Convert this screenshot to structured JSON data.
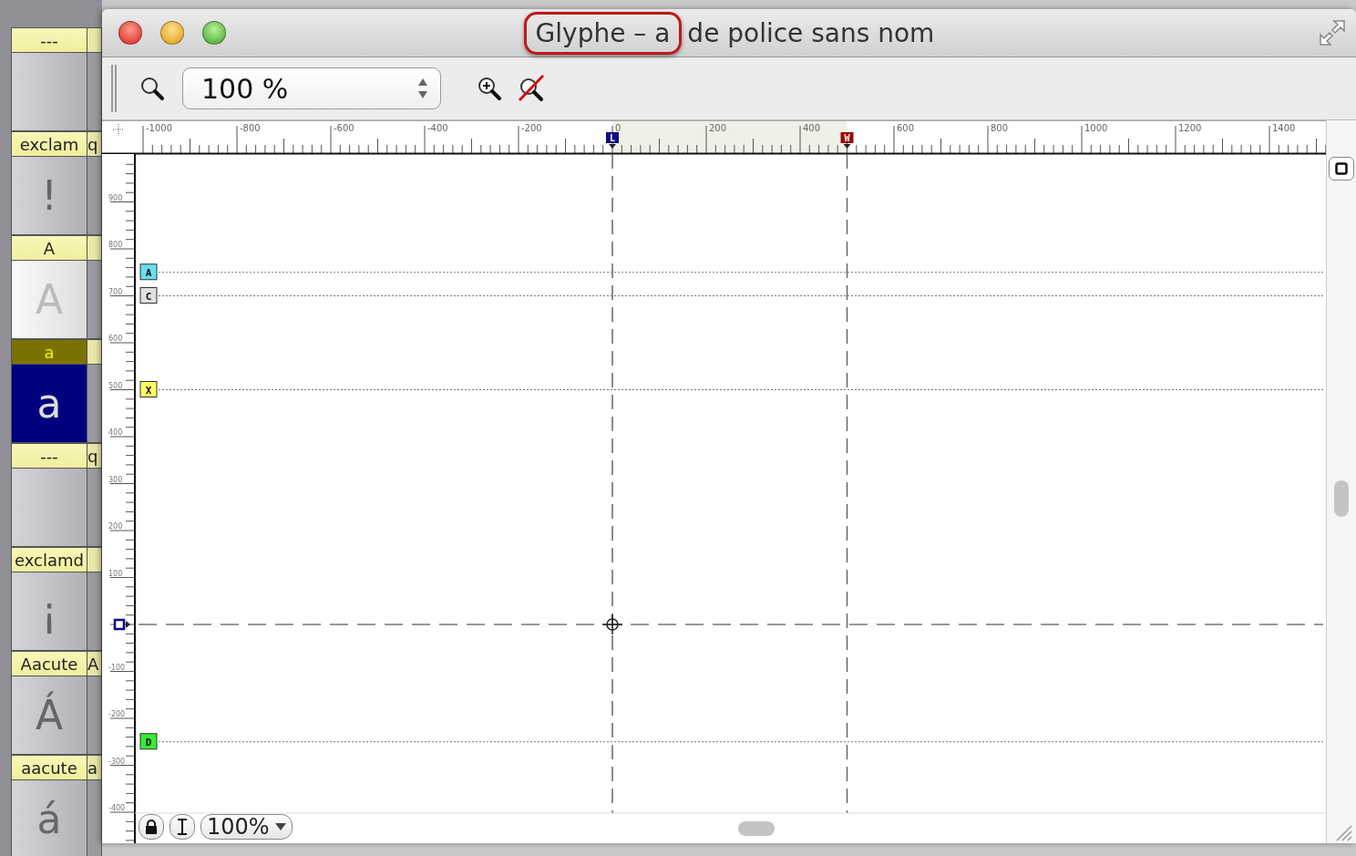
{
  "glyph_grid": [
    {
      "name": "---",
      "selected": false,
      "highlighted": false
    },
    {
      "name": "exclam",
      "glyph": "!",
      "neighbor": "q",
      "selected": false,
      "highlighted": false
    },
    {
      "name": "A",
      "glyph": "A",
      "selected": false,
      "highlighted": true
    },
    {
      "name": "a",
      "glyph": "a",
      "selected": true,
      "highlighted": false
    },
    {
      "name": "---",
      "neighbor": "q",
      "selected": false,
      "highlighted": false
    },
    {
      "name": "exclamd",
      "glyph": "¡",
      "selected": false,
      "highlighted": false
    },
    {
      "name": "Aacute",
      "glyph": "Á",
      "neighbor": "A",
      "selected": false,
      "highlighted": false
    },
    {
      "name": "aacute",
      "glyph": "á",
      "neighbor": "a",
      "selected": false,
      "highlighted": false
    }
  ],
  "window": {
    "title_parts": [
      {
        "text": "Glyphe – a",
        "highlighted": true
      },
      {
        "text": "de police sans nom",
        "highlighted": false
      }
    ]
  },
  "toolbar": {
    "zoom_field": {
      "value": "100 %"
    }
  },
  "rulers": {
    "horizontal": [
      "-1000",
      "-800",
      "-600",
      "-400",
      "-200",
      "0",
      "200",
      "400",
      "600",
      "800",
      "1000",
      "1200",
      "1400"
    ],
    "vertical": [
      "900",
      "800",
      "700",
      "600",
      "500",
      "400",
      "300",
      "200",
      "100",
      "-100",
      "-200",
      "-300",
      "-400"
    ]
  },
  "guides": [
    {
      "label": "A",
      "kind": "ascender",
      "color": "#66e0f0"
    },
    {
      "label": "C",
      "kind": "cap_height",
      "color": "#e0e0e0"
    },
    {
      "label": "X",
      "kind": "x_height",
      "color": "#ffff66"
    },
    {
      "label": "D",
      "kind": "descender",
      "color": "#33ee33"
    }
  ],
  "vertical_guides": [
    {
      "label": "L",
      "kind": "left_bearing",
      "color": "#0a0a8a"
    },
    {
      "label": "W",
      "kind": "advance_width",
      "color": "#9a0a0a"
    }
  ],
  "bottom_bar": {
    "zoom_popup": "100%"
  }
}
